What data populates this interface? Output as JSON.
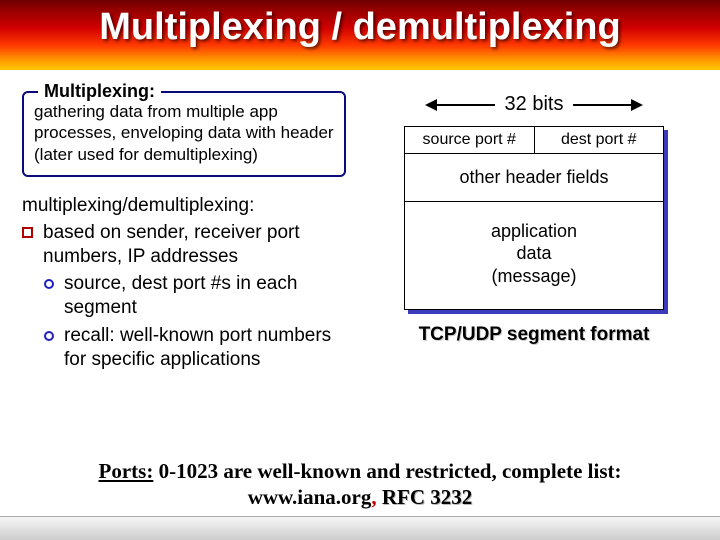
{
  "title": "Multiplexing / demultiplexing",
  "left": {
    "box_legend": "Multiplexing:",
    "box_body": "gathering data from multiple app processes, enveloping data with header (later used for demultiplexing)",
    "heading": "multiplexing/demultiplexing:",
    "bullet1": "based on sender, receiver port numbers, IP addresses",
    "sub1": "source, dest port #s in each segment",
    "sub2": "recall: well-known port numbers for specific applications"
  },
  "right": {
    "bits_label": "32 bits",
    "source_port": "source port #",
    "dest_port": "dest port #",
    "other_fields": "other header fields",
    "app_data_l1": "application",
    "app_data_l2": "data",
    "app_data_l3": "(message)",
    "caption": "TCP/UDP segment format"
  },
  "footer": {
    "ports_label": "Ports:",
    "line1_rest": " 0-1023 are well-known and restricted,  complete list:",
    "url": "www.iana.org",
    "rfc": "RFC 3232"
  }
}
